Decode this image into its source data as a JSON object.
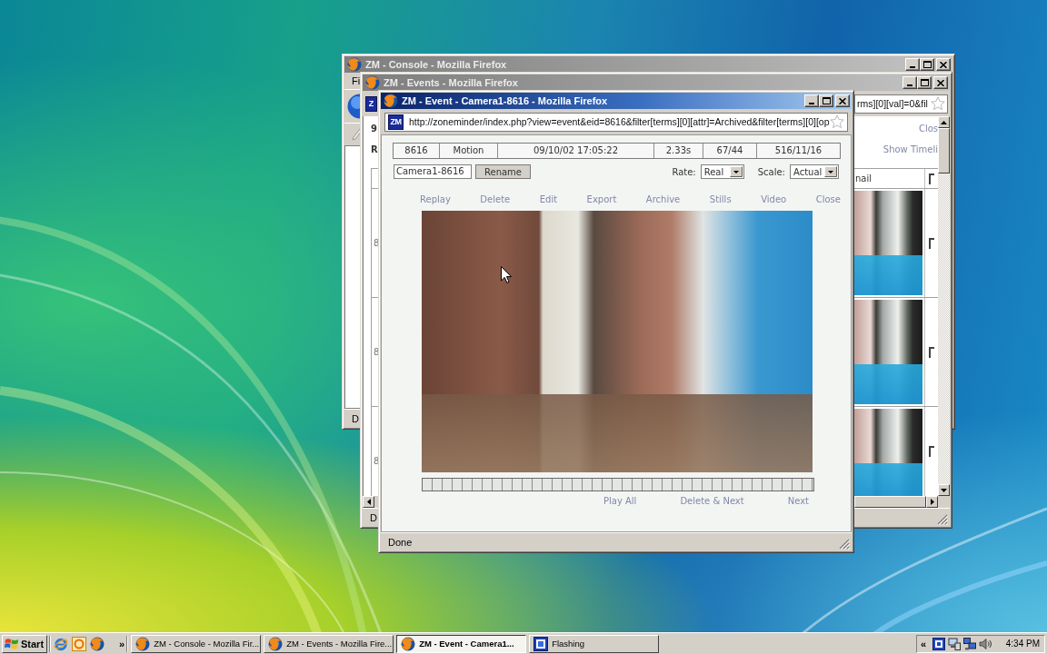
{
  "console_window": {
    "title": "ZM - Console - Mozilla Firefox",
    "active": false,
    "menu": [
      "Fi"
    ],
    "status": "D"
  },
  "events_window": {
    "title": "ZM - Events - Mozilla Firefox",
    "active": false,
    "logo": "Z",
    "address": "rms][0][val]=0&fil",
    "left_texts": [
      "9",
      "R"
    ],
    "right_links": [
      "Clos",
      "Show Timeli"
    ],
    "table": {
      "heading": "nail",
      "heading_checked": false,
      "rows": [
        {
          "cell": "8",
          "checked": false
        },
        {
          "cell": "8",
          "checked": false
        },
        {
          "cell": "8",
          "checked": false
        }
      ]
    },
    "status": "D"
  },
  "event_window": {
    "title": "ZM - Event - Camera1-8616 - Mozilla Firefox",
    "active": true,
    "logo": "ZM",
    "address": "http://zoneminder/index.php?view=event&eid=8616&filter[terms][0][attr]=Archived&filter[terms][0][op",
    "info": [
      "8616",
      "Motion",
      "09/10/02 17:05:22",
      "2.33s",
      "67/44",
      "516/11/16"
    ],
    "name_field": {
      "value": "Camera1-8616"
    },
    "rename_button": "Rename",
    "rate": {
      "label": "Rate:",
      "value": "Real"
    },
    "scale": {
      "label": "Scale:",
      "value": "Actual"
    },
    "actions": [
      "Replay",
      "Delete",
      "Edit",
      "Export",
      "Archive",
      "Stills",
      "Video",
      "Close"
    ],
    "nav": [
      "Play All",
      "Delete & Next",
      "Next"
    ],
    "status": "Done"
  },
  "taskbar": {
    "start": "Start",
    "quick_launch_more": "»",
    "tasks": [
      {
        "kind": "browser",
        "label": "ZM - Console - Mozilla Fir...",
        "selected": false
      },
      {
        "kind": "browser",
        "label": "ZM - Events - Mozilla Fire...",
        "selected": false
      },
      {
        "kind": "browser",
        "label": "ZM - Event - Camera1...",
        "selected": true
      },
      {
        "kind": "app",
        "label": "Flashing",
        "selected": false
      }
    ],
    "tray_more": "«",
    "clock": "4:34 PM"
  }
}
